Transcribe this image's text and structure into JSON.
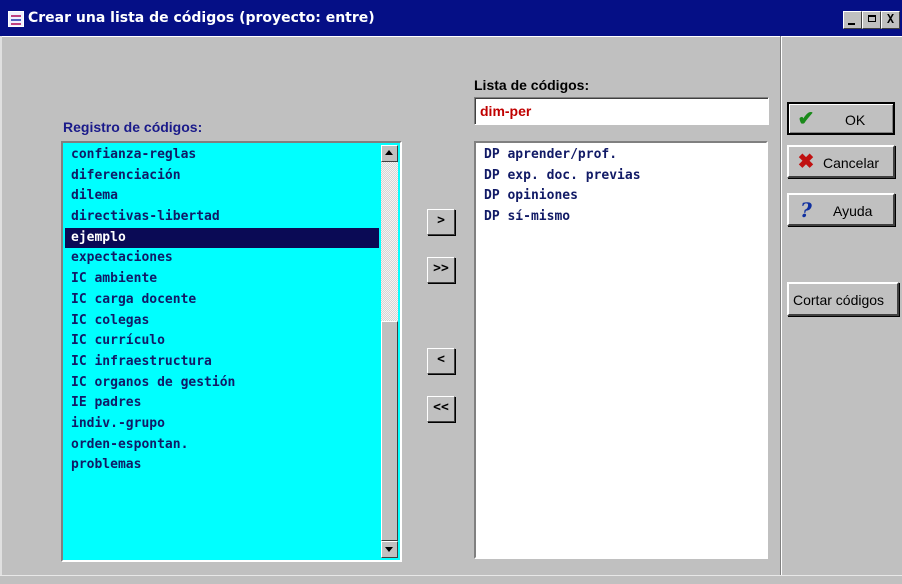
{
  "window": {
    "title": "Crear una lista de códigos (proyecto: entre)",
    "controls": {
      "minimize": "_",
      "maximize": "□",
      "close": "X"
    }
  },
  "registro": {
    "label": "Registro de códigos:",
    "items": [
      "confianza-reglas",
      "diferenciación",
      "dilema",
      "directivas-libertad",
      "ejemplo",
      "expectaciones",
      "IC ambiente",
      "IC carga docente",
      "IC colegas",
      "IC currículo",
      "IC infraestructura",
      "IC organos de gestión",
      "IE padres",
      "indiv.-grupo",
      "orden-espontan.",
      "problemas"
    ],
    "selected_index": 4
  },
  "lista": {
    "label": "Lista de códigos:",
    "name_value": "dim-per",
    "items": [
      "DP aprender/prof.",
      "DP exp. doc. previas",
      "DP opiniones",
      "DP sí-mismo"
    ]
  },
  "move_buttons": {
    "add": ">",
    "add_all": ">>",
    "remove": "<",
    "remove_all": "<<"
  },
  "actions": {
    "ok": "OK",
    "cancel": "Cancelar",
    "help": "Ayuda",
    "cut": "Cortar códigos"
  },
  "icons": {
    "ok": "check-icon",
    "cancel": "x-icon",
    "help": "question-icon"
  },
  "colors": {
    "titlebar": "#050f86",
    "registro_bg": "#00ffff",
    "selection_bg": "#0a0a55",
    "name_text": "#c00000"
  }
}
